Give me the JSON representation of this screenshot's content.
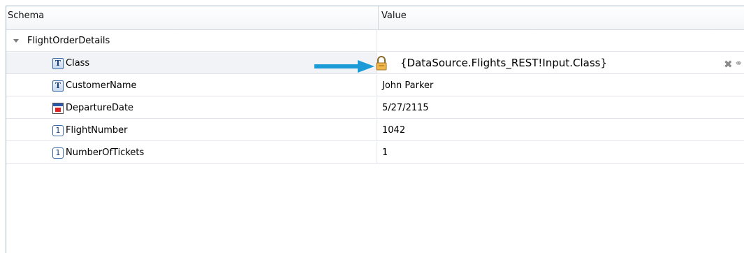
{
  "header": {
    "schema_label": "Schema",
    "value_label": "Value"
  },
  "parent": {
    "label": "FlightOrderDetails"
  },
  "rows": [
    {
      "icon": "T",
      "type": "text",
      "name": "Class",
      "value": "{DataSource.Flights_REST!Input.Class}"
    },
    {
      "icon": "T",
      "type": "text",
      "name": "CustomerName",
      "value": "John Parker"
    },
    {
      "icon": "",
      "type": "date",
      "name": "DepartureDate",
      "value": "5/27/2115"
    },
    {
      "icon": "1",
      "type": "number",
      "name": "FlightNumber",
      "value": "1042"
    },
    {
      "icon": "1",
      "type": "number",
      "name": "NumberOfTickets",
      "value": "1"
    }
  ],
  "colors": {
    "arrow": "#1a9bd7",
    "border": "#a7b5c8"
  }
}
